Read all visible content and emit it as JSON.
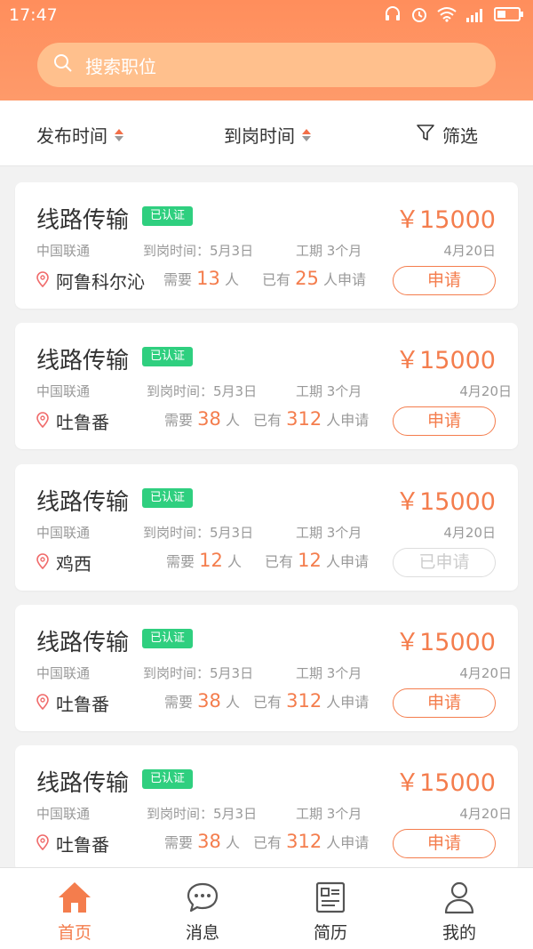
{
  "status": {
    "time": "17:47"
  },
  "search": {
    "placeholder": "搜索职位"
  },
  "filters": [
    {
      "label": "发布时间"
    },
    {
      "label": "到岗时间"
    },
    {
      "label": "筛选"
    }
  ],
  "jobs": [
    {
      "title": "线路传输",
      "badge": "已认证",
      "salary": "￥15000",
      "company": "中国联通",
      "start": "到岗时间：5月3日",
      "duration": "工期 3个月",
      "date": "4月20日",
      "location": "阿鲁科尔沁",
      "need_pre": "需要",
      "need": "13",
      "need_post": "人",
      "applied_pre": "已有",
      "applied": "25",
      "applied_post": "人申请",
      "button": "申请"
    },
    {
      "title": "线路传输",
      "badge": "已认证",
      "salary": "￥15000",
      "company": "中国联通",
      "start": "到岗时间：5月3日",
      "duration": "工期 3个月",
      "date": "4月20日",
      "location": "吐鲁番",
      "need_pre": "需要",
      "need": "38",
      "need_post": "人",
      "applied_pre": "已有",
      "applied": "312",
      "applied_post": "人申请",
      "button": "申请"
    },
    {
      "title": "线路传输",
      "badge": "已认证",
      "salary": "￥15000",
      "company": "中国联通",
      "start": "到岗时间：5月3日",
      "duration": "工期 3个月",
      "date": "4月20日",
      "location": "鸡西",
      "need_pre": "需要",
      "need": "12",
      "need_post": "人",
      "applied_pre": "已有",
      "applied": "12",
      "applied_post": "人申请",
      "button": "已申请"
    },
    {
      "title": "线路传输",
      "badge": "已认证",
      "salary": "￥15000",
      "company": "中国联通",
      "start": "到岗时间：5月3日",
      "duration": "工期 3个月",
      "date": "4月20日",
      "location": "吐鲁番",
      "need_pre": "需要",
      "need": "38",
      "need_post": "人",
      "applied_pre": "已有",
      "applied": "312",
      "applied_post": "人申请",
      "button": "申请"
    },
    {
      "title": "线路传输",
      "badge": "已认证",
      "salary": "￥15000",
      "company": "中国联通",
      "start": "到岗时间：5月3日",
      "duration": "工期 3个月",
      "date": "4月20日",
      "location": "吐鲁番",
      "need_pre": "需要",
      "need": "38",
      "need_post": "人",
      "applied_pre": "已有",
      "applied": "312",
      "applied_post": "人申请",
      "button": "申请"
    }
  ],
  "tabs": [
    {
      "label": "首页"
    },
    {
      "label": "消息"
    },
    {
      "label": "简历"
    },
    {
      "label": "我的"
    }
  ],
  "colors": {
    "accent": "#f47d4d",
    "badge": "#2fcf7f",
    "header": "#ff8e5c"
  }
}
